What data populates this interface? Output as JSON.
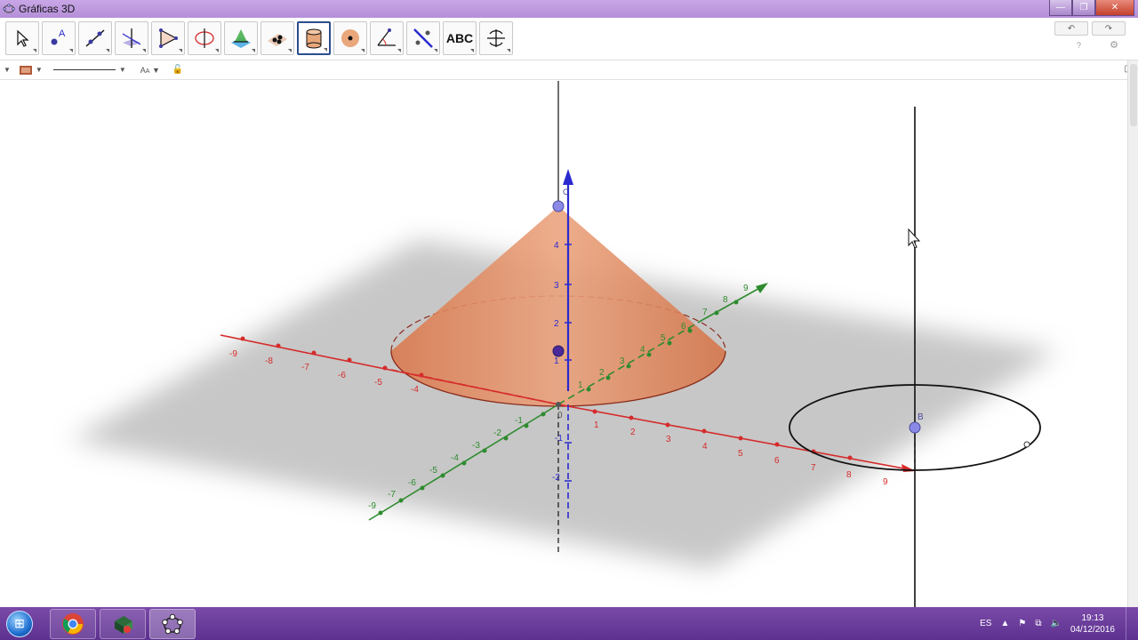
{
  "window": {
    "title": "Gráficas 3D",
    "buttons": [
      "—",
      "❐",
      "✕"
    ]
  },
  "toolbar": {
    "tools": [
      {
        "name": "move-tool",
        "icon": "arrow-cursor-icon"
      },
      {
        "name": "point-tool",
        "icon": "point-a-icon"
      },
      {
        "name": "line-tool",
        "icon": "line-icon"
      },
      {
        "name": "perpendicular-tool",
        "icon": "perpendicular-icon"
      },
      {
        "name": "polygon-tool",
        "icon": "triangle-icon"
      },
      {
        "name": "circle-tool",
        "icon": "circle-axis-icon"
      },
      {
        "name": "intersect-surfaces-tool",
        "icon": "plane-intersection-icon"
      },
      {
        "name": "plane-tool",
        "icon": "plane-points-icon"
      },
      {
        "name": "cylinder-tool",
        "icon": "cylinder-icon"
      },
      {
        "name": "sphere-tool",
        "icon": "sphere-icon"
      },
      {
        "name": "angle-tool",
        "icon": "angle-icon"
      },
      {
        "name": "reflect-tool",
        "icon": "reflect-icon"
      },
      {
        "name": "text-tool",
        "label": "ABC"
      },
      {
        "name": "rotate-view-tool",
        "icon": "rotate-view-icon"
      }
    ],
    "active_index": 8,
    "undo": "↶",
    "redo": "↷",
    "help": "?",
    "settings": "⚙"
  },
  "stylebar": {
    "color": "#e0a080",
    "label_toggle": "A",
    "lock": "🔓"
  },
  "axes": {
    "x_ticks": [
      "-9",
      "-8",
      "-7",
      "-6",
      "-5",
      "-4",
      "1",
      "2",
      "3",
      "4",
      "5",
      "6",
      "7",
      "8",
      "9"
    ],
    "y_ticks": [
      "-9",
      "-7",
      "-6",
      "-5",
      "-4",
      "-3",
      "-2",
      "-1",
      "1",
      "2",
      "3",
      "4",
      "5",
      "6",
      "7",
      "8",
      "9"
    ],
    "z_ticks": [
      "1",
      "2",
      "3",
      "4",
      "-1",
      "-2"
    ],
    "x_color": "#d62b2b",
    "y_color": "#2e8b2e",
    "z_color": "#2a2acf",
    "origin_label": "0"
  },
  "objects": {
    "cone_fill": "#e0875a",
    "point_b_label": "B",
    "point_c_label": "C"
  },
  "taskbar": {
    "language": "ES",
    "time": "19:13",
    "date": "04/12/2016"
  }
}
